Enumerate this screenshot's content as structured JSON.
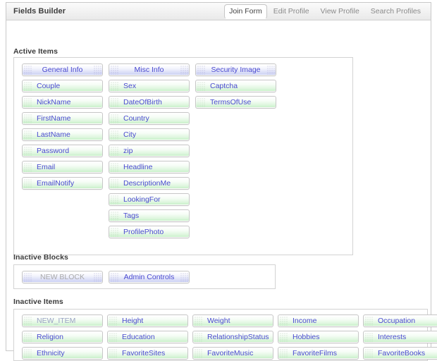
{
  "header": {
    "title": "Fields Builder",
    "tabs": [
      {
        "label": "Join Form",
        "active": true
      },
      {
        "label": "Edit Profile",
        "active": false
      },
      {
        "label": "View Profile",
        "active": false
      },
      {
        "label": "Search Profiles",
        "active": false
      }
    ]
  },
  "active_items": {
    "label": "Active Items",
    "columns": [
      {
        "block": {
          "label": "General Info",
          "type": "block"
        },
        "items": [
          {
            "label": "Couple"
          },
          {
            "label": "NickName"
          },
          {
            "label": "FirstName"
          },
          {
            "label": "LastName"
          },
          {
            "label": "Password"
          },
          {
            "label": "Email"
          },
          {
            "label": "EmailNotify"
          }
        ]
      },
      {
        "block": {
          "label": "Misc Info",
          "type": "block"
        },
        "items": [
          {
            "label": "Sex"
          },
          {
            "label": "DateOfBirth"
          },
          {
            "label": "Country"
          },
          {
            "label": "City"
          },
          {
            "label": "zip"
          },
          {
            "label": "Headline"
          },
          {
            "label": "DescriptionMe"
          },
          {
            "label": "LookingFor"
          },
          {
            "label": "Tags"
          },
          {
            "label": "ProfilePhoto"
          }
        ]
      },
      {
        "block": {
          "label": "Security Image",
          "type": "block"
        },
        "items": [
          {
            "label": "Captcha"
          },
          {
            "label": "TermsOfUse"
          }
        ]
      }
    ]
  },
  "inactive_blocks": {
    "label": "Inactive Blocks",
    "blocks": [
      {
        "label": "NEW BLOCK",
        "muted": true
      },
      {
        "label": "Admin Controls",
        "muted": false
      }
    ]
  },
  "inactive_items": {
    "label": "Inactive Items",
    "items": [
      {
        "label": "NEW_ITEM",
        "muted": true
      },
      {
        "label": "Height",
        "muted": false
      },
      {
        "label": "Weight",
        "muted": false
      },
      {
        "label": "Income",
        "muted": false
      },
      {
        "label": "Occupation",
        "muted": false
      },
      {
        "label": "Religion",
        "muted": false
      },
      {
        "label": "Education",
        "muted": false
      },
      {
        "label": "RelationshipStatus",
        "muted": false
      },
      {
        "label": "Hobbies",
        "muted": false
      },
      {
        "label": "Interests",
        "muted": false
      },
      {
        "label": "Ethnicity",
        "muted": false
      },
      {
        "label": "FavoriteSites",
        "muted": false
      },
      {
        "label": "FavoriteMusic",
        "muted": false
      },
      {
        "label": "FavoriteFilms",
        "muted": false
      },
      {
        "label": "FavoriteBooks",
        "muted": false
      }
    ]
  },
  "colors": {
    "block_text": "#4a4ad0",
    "item_text": "#4a4ad0",
    "muted_text": "#a9a9a9",
    "panel_border": "#d3d3d3",
    "header_bg": "#f2f2f2"
  }
}
